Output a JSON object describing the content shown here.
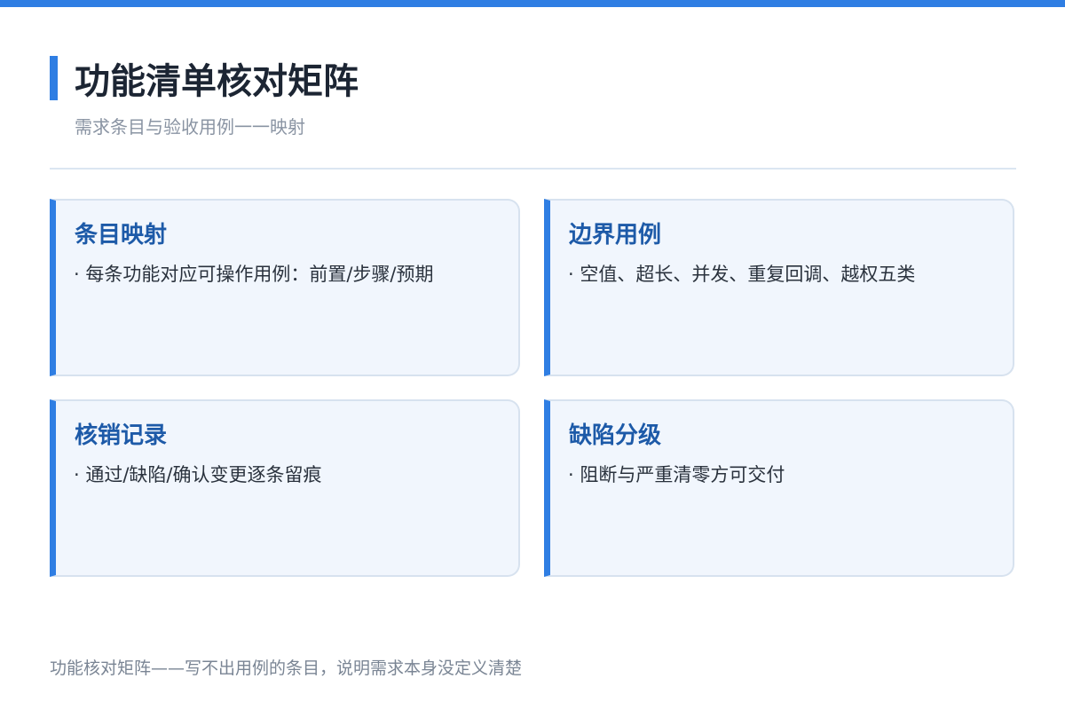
{
  "header": {
    "title": "功能清单核对矩阵",
    "subtitle": "需求条目与验收用例一一映射"
  },
  "cards": [
    {
      "title": "条目映射",
      "body": "· 每条功能对应可操作用例：前置/步骤/预期"
    },
    {
      "title": "边界用例",
      "body": "· 空值、超长、并发、重复回调、越权五类"
    },
    {
      "title": "核销记录",
      "body": "· 通过/缺陷/确认变更逐条留痕"
    },
    {
      "title": "缺陷分级",
      "body": "· 阻断与严重清零方可交付"
    }
  ],
  "footer": {
    "note": "功能核对矩阵——写不出用例的条目，说明需求本身没定义清楚"
  },
  "colors": {
    "accent": "#2f7ee3",
    "card_background": "#f1f6fd",
    "card_title": "#1d5aa8"
  }
}
